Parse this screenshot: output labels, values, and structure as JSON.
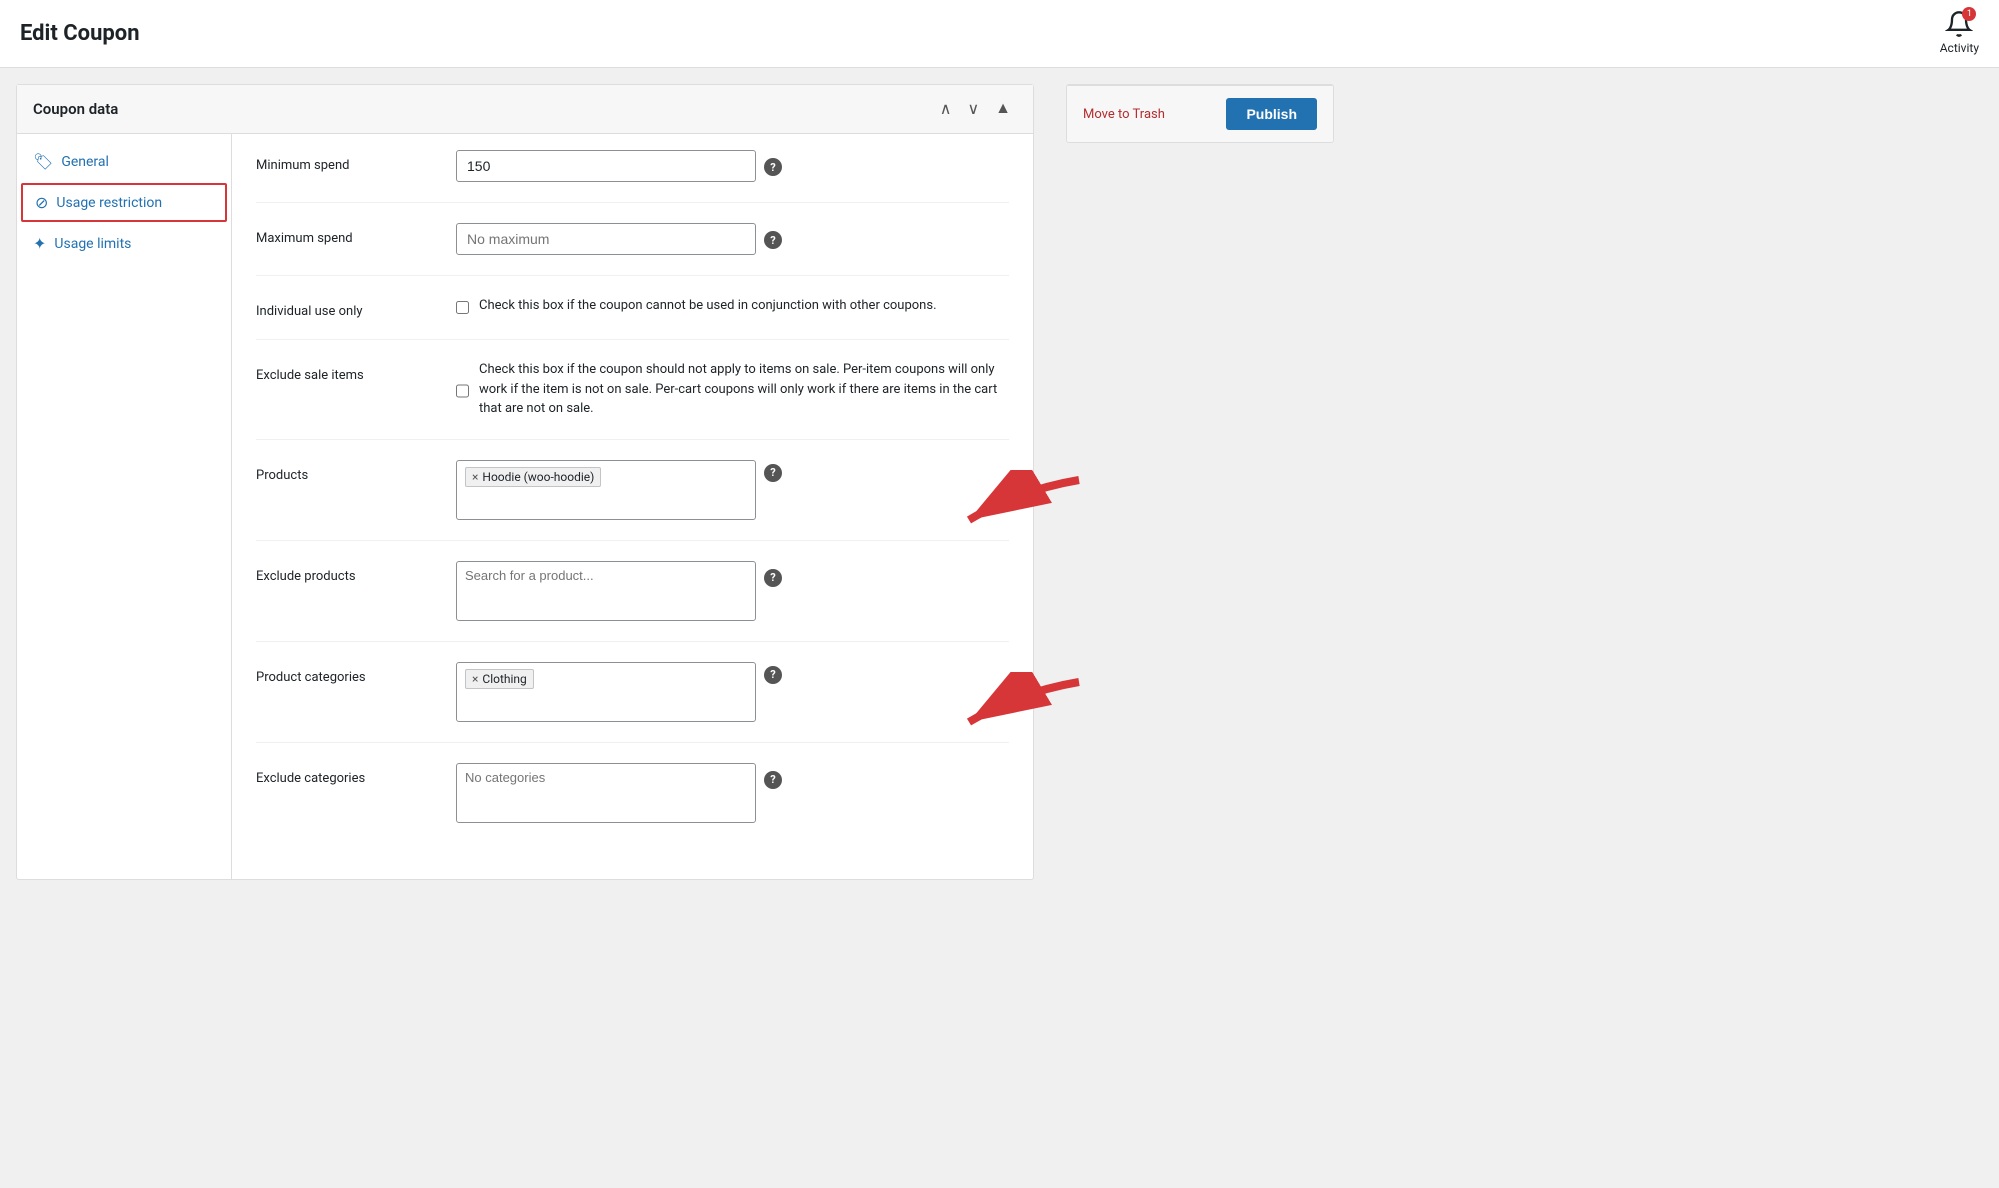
{
  "header": {
    "title": "Edit Coupon",
    "activity_label": "Activity",
    "activity_badge": "1"
  },
  "sidebar": {
    "move_to_trash": "Move to Trash",
    "publish": "Publish"
  },
  "coupon_panel": {
    "title": "Coupon data",
    "nav": [
      {
        "id": "general",
        "label": "General",
        "icon": "🏷"
      },
      {
        "id": "usage-restriction",
        "label": "Usage restriction",
        "icon": "⊘",
        "active": true
      },
      {
        "id": "usage-limits",
        "label": "Usage limits",
        "icon": "✦"
      }
    ],
    "fields": {
      "minimum_spend": {
        "label": "Minimum spend",
        "value": "150",
        "placeholder": ""
      },
      "maximum_spend": {
        "label": "Maximum spend",
        "value": "",
        "placeholder": "No maximum"
      },
      "individual_use": {
        "label": "Individual use only",
        "checked": false,
        "description": "Check this box if the coupon cannot be used in conjunction with other coupons."
      },
      "exclude_sale": {
        "label": "Exclude sale items",
        "checked": false,
        "description": "Check this box if the coupon should not apply to items on sale. Per-item coupons will only work if the item is not on sale. Per-cart coupons will only work if there are items in the cart that are not on sale."
      },
      "products": {
        "label": "Products",
        "tags": [
          "Hoodie (woo-hoodie)"
        ],
        "placeholder": ""
      },
      "exclude_products": {
        "label": "Exclude products",
        "tags": [],
        "placeholder": "Search for a product..."
      },
      "product_categories": {
        "label": "Product categories",
        "tags": [
          "Clothing"
        ],
        "placeholder": ""
      },
      "exclude_categories": {
        "label": "Exclude categories",
        "tags": [],
        "placeholder": "No categories"
      }
    }
  }
}
